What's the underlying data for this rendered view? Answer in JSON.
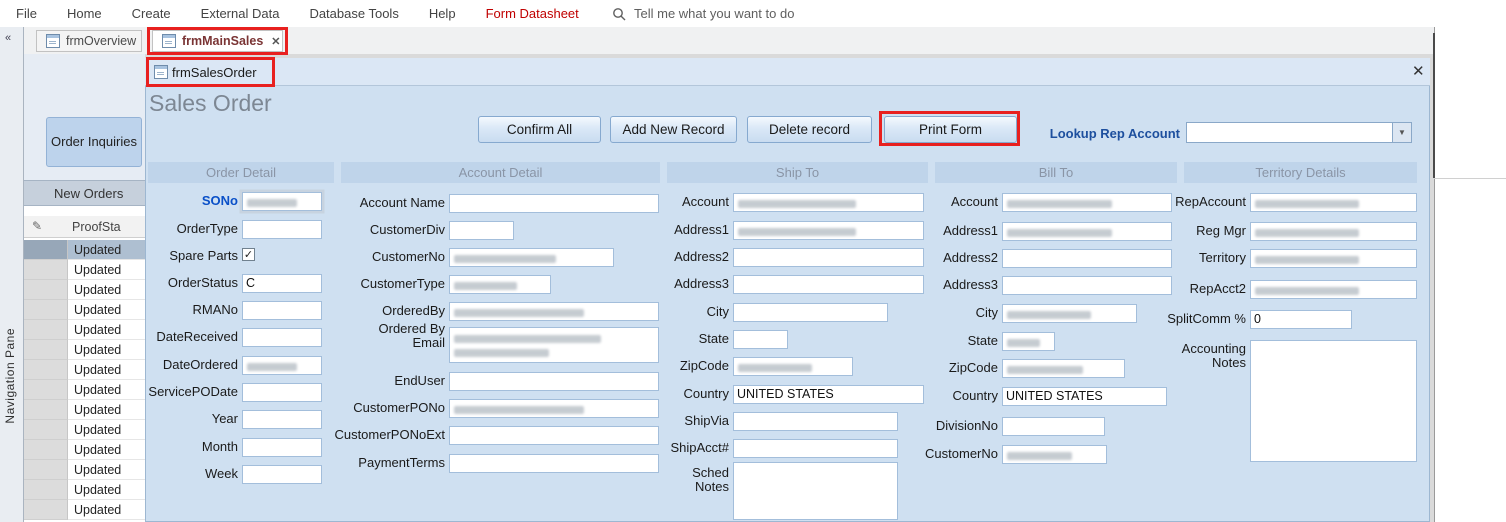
{
  "ribbon": {
    "items": [
      {
        "label": "File"
      },
      {
        "label": "Home"
      },
      {
        "label": "Create"
      },
      {
        "label": "External Data"
      },
      {
        "label": "Database Tools"
      },
      {
        "label": "Help"
      },
      {
        "label": "Form Datasheet",
        "accent": true
      }
    ],
    "search_text": "Tell me what you want to do"
  },
  "doc_tabs": [
    {
      "label": "frmOverview",
      "active": false
    },
    {
      "label": "frmMainSales",
      "active": true,
      "closable": true
    }
  ],
  "nav_pane": {
    "label": "Navigation Pane",
    "collapse_icon": "«"
  },
  "sidebar": {
    "inquiries_button": "Order Inquiries",
    "group_header": "New Orders",
    "list_header": "ProofSta",
    "pencil_icon": "✎",
    "selected_index": 0,
    "rows": [
      "Updated",
      "Updated",
      "Updated",
      "Updated",
      "Updated",
      "Updated",
      "Updated",
      "Updated",
      "Updated",
      "Updated",
      "Updated",
      "Updated",
      "Updated",
      "Updated"
    ]
  },
  "window": {
    "title": "frmSalesOrder",
    "close_icon": "✕",
    "heading": "Sales Order",
    "lookup_label": "Lookup Rep Account",
    "lookup_value": "",
    "buttons": [
      "Confirm All",
      "Add New Record",
      "Delete record",
      "Print Form"
    ]
  },
  "sections": {
    "order_detail": {
      "header": "Order Detail",
      "fields": [
        {
          "label": "SONo",
          "value": "",
          "masked": true,
          "accent": true,
          "focus": true
        },
        {
          "label": "OrderType",
          "value": ""
        },
        {
          "label": "Spare Parts",
          "checkbox": true,
          "checked": true
        },
        {
          "label": "OrderStatus",
          "value": "C"
        },
        {
          "label": "RMANo",
          "value": ""
        },
        {
          "label": "DateReceived",
          "value": ""
        },
        {
          "label": "DateOrdered",
          "value": "",
          "masked": true
        },
        {
          "label": "ServicePODate",
          "value": ""
        },
        {
          "label": "Year",
          "value": ""
        },
        {
          "label": "Month",
          "value": ""
        },
        {
          "label": "Week",
          "value": ""
        }
      ]
    },
    "account_detail": {
      "header": "Account  Detail",
      "fields": [
        {
          "label": "Account Name",
          "value": ""
        },
        {
          "label": "CustomerDiv",
          "value": ""
        },
        {
          "label": "CustomerNo",
          "value": "",
          "masked": true
        },
        {
          "label": "CustomerType",
          "value": "",
          "masked": true
        },
        {
          "label": "OrderedBy",
          "value": "",
          "masked": true
        },
        {
          "label": "Ordered By Email",
          "value": "",
          "masked": true
        },
        {
          "label": "EndUser",
          "value": ""
        },
        {
          "label": "CustomerPONo",
          "value": "",
          "masked": true
        },
        {
          "label": "CustomerPONoExt",
          "value": ""
        },
        {
          "label": "PaymentTerms",
          "value": ""
        }
      ]
    },
    "ship_to": {
      "header": "Ship To",
      "fields": [
        {
          "label": "Account",
          "value": "",
          "masked": true
        },
        {
          "label": "Address1",
          "value": "",
          "masked": true
        },
        {
          "label": "Address2",
          "value": ""
        },
        {
          "label": "Address3",
          "value": ""
        },
        {
          "label": "City",
          "value": ""
        },
        {
          "label": "State",
          "value": ""
        },
        {
          "label": "ZipCode",
          "value": "",
          "masked": true
        },
        {
          "label": "Country",
          "value": "UNITED STATES"
        },
        {
          "label": "ShipVia",
          "value": ""
        },
        {
          "label": "ShipAcct#",
          "value": ""
        },
        {
          "label": "Sched Notes",
          "value": "",
          "textarea": true
        }
      ]
    },
    "bill_to": {
      "header": "Bill To",
      "fields": [
        {
          "label": "Account",
          "value": "",
          "masked": true
        },
        {
          "label": "Address1",
          "value": "",
          "masked": true
        },
        {
          "label": "Address2",
          "value": ""
        },
        {
          "label": "Address3",
          "value": ""
        },
        {
          "label": "City",
          "value": "",
          "masked": true
        },
        {
          "label": "State",
          "value": "",
          "masked": true
        },
        {
          "label": "ZipCode",
          "value": "",
          "masked": true
        },
        {
          "label": "Country",
          "value": "UNITED STATES"
        },
        {
          "label": "DivisionNo",
          "value": ""
        },
        {
          "label": "CustomerNo",
          "value": "",
          "masked": true
        }
      ]
    },
    "territory": {
      "header": "Territory Details",
      "fields": [
        {
          "label": "RepAccount",
          "value": "",
          "masked": true
        },
        {
          "label": "Reg Mgr",
          "value": "",
          "masked": true
        },
        {
          "label": "Territory",
          "value": "",
          "masked": true
        },
        {
          "label": "RepAcct2",
          "value": "",
          "masked": true
        },
        {
          "label": "SplitComm %",
          "value": "0"
        },
        {
          "label": "Accounting Notes",
          "value": "",
          "textarea": true
        }
      ]
    }
  },
  "colors": {
    "annotation_red": "#e8201f",
    "ribbon_accent": "#c00000",
    "sono_label_blue": "#0a50c8",
    "lookup_blue": "#1d4f9e",
    "form_background": "#cfe0f1"
  }
}
